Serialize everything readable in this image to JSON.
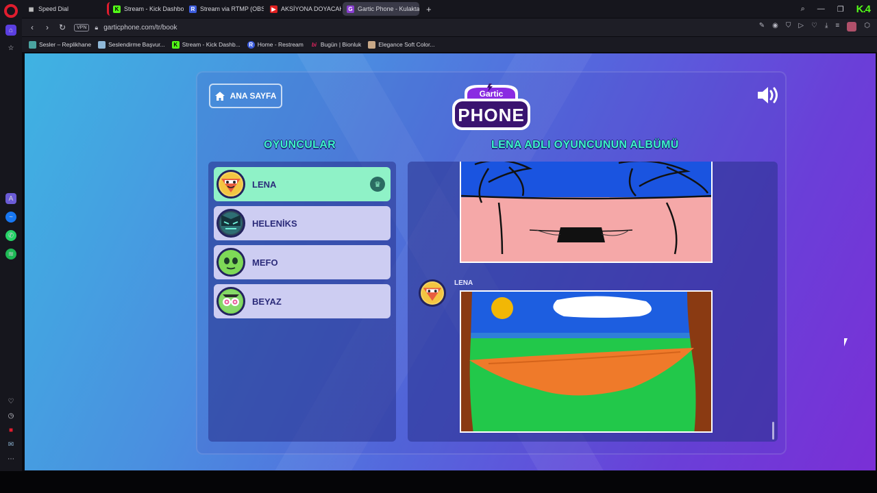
{
  "browser": {
    "tabs": [
      {
        "label": "Speed Dial",
        "icon": "speed-dial-icon"
      },
      {
        "label": "Stream - Kick Dashboard",
        "icon": "kick-icon",
        "color": "#53fc18"
      },
      {
        "label": "Stream via RTMP (OBS, Vi",
        "icon": "restream-icon",
        "color": "#3b5bdb"
      },
      {
        "label": "AKSİYONA DOYACAKSINIZ",
        "icon": "youtube-icon",
        "color": "#e02020"
      },
      {
        "label": "Gartic Phone - Kulaktan K",
        "icon": "gartic-icon",
        "color": "#8a3fd1"
      }
    ],
    "url": "garticphone.com/tr/book",
    "vpn_label": "VPN",
    "bookmarks": [
      {
        "label": "Sesler – Replikhane",
        "color": "#4aa3a0"
      },
      {
        "label": "Seslendirme Başvur...",
        "color": "#8fb8d8"
      },
      {
        "label": "Stream - Kick Dashb...",
        "color": "#53fc18"
      },
      {
        "label": "Home - Restream",
        "color": "#3b5bdb"
      },
      {
        "label": "Bugün | Bionluk",
        "color": "#e0245e"
      },
      {
        "label": "Elegance Soft Color...",
        "color": "#c8a887"
      }
    ]
  },
  "game": {
    "home_button": "ANA SAYFA",
    "logo_top": "Gartic",
    "logo_bottom": "PHONE",
    "players_heading": "OYUNCULAR",
    "album_heading": "LENA ADLI OYUNCUNUN ALBÜMÜ",
    "players": [
      {
        "name": "LENA",
        "active": true,
        "host": true
      },
      {
        "name": "HELENİKS",
        "active": false
      },
      {
        "name": "MEFO",
        "active": false
      },
      {
        "name": "BEYAZ",
        "active": false
      }
    ],
    "album_author": "LENA"
  },
  "colors": {
    "accent_heading": "#3df2c6",
    "active_player": "#8ff2c7",
    "player_row": "#cdcdf2"
  }
}
